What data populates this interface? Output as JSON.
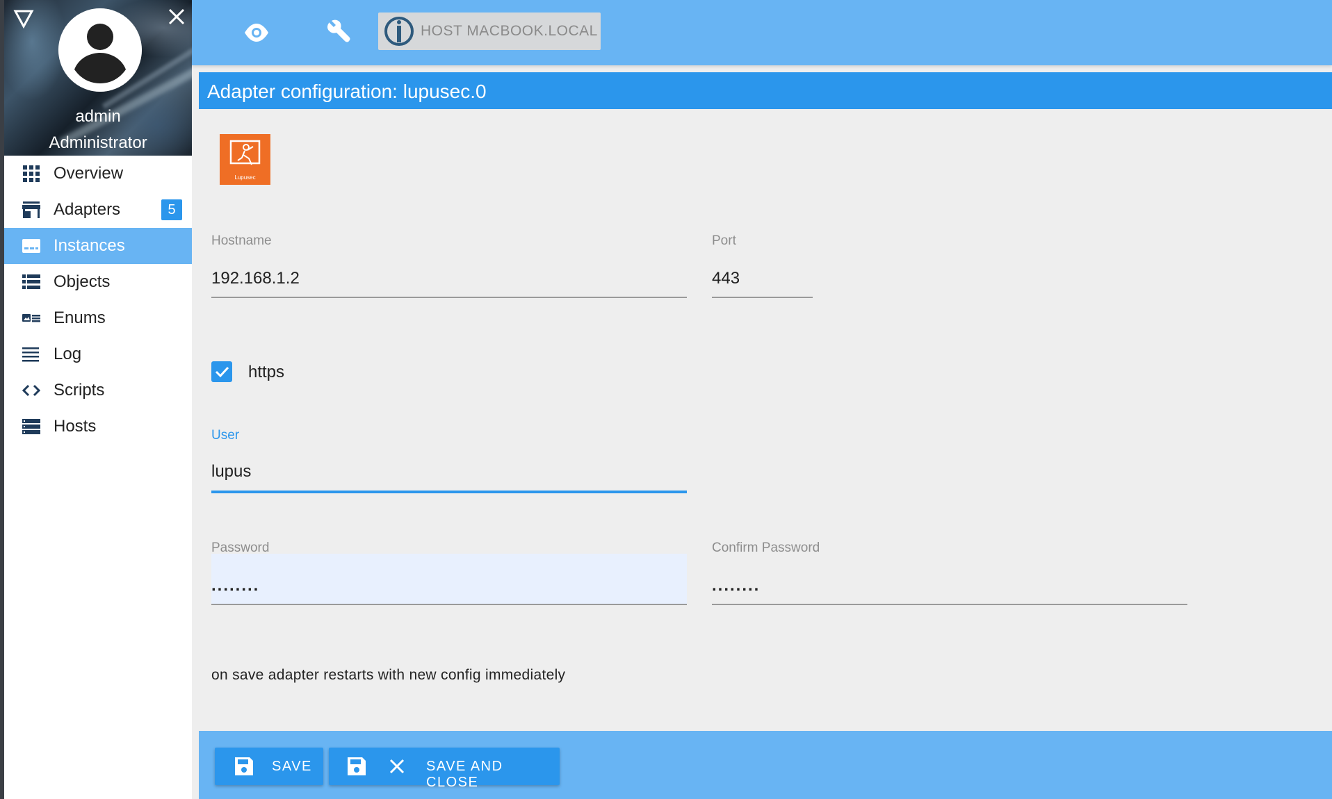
{
  "sidebar": {
    "user_name": "admin",
    "user_role": "Administrator",
    "items": [
      {
        "label": "Overview",
        "icon": "grid-icon"
      },
      {
        "label": "Adapters",
        "icon": "store-icon",
        "badge": "5"
      },
      {
        "label": "Instances",
        "icon": "instances-icon",
        "active": true
      },
      {
        "label": "Objects",
        "icon": "list-icon"
      },
      {
        "label": "Enums",
        "icon": "enum-icon"
      },
      {
        "label": "Log",
        "icon": "log-icon"
      },
      {
        "label": "Scripts",
        "icon": "code-icon"
      },
      {
        "label": "Hosts",
        "icon": "hosts-icon"
      }
    ]
  },
  "topbar": {
    "host_label": "HOST MACBOOK.LOCAL"
  },
  "page": {
    "title": "Adapter configuration: lupusec.0",
    "logo_caption": "Lupusec"
  },
  "form": {
    "hostname": {
      "label": "Hostname",
      "value": "192.168.1.2"
    },
    "port": {
      "label": "Port",
      "value": "443"
    },
    "https": {
      "label": "https",
      "checked": true
    },
    "user": {
      "label": "User",
      "value": "lupus"
    },
    "password": {
      "label": "Password",
      "value": "........"
    },
    "confirm_password": {
      "label": "Confirm Password",
      "value": "........"
    },
    "note": "on save adapter restarts with new config immediately"
  },
  "actions": {
    "save_label": "SAVE",
    "save_close_label": "SAVE AND CLOSE"
  },
  "colors": {
    "primary": "#2b96ec",
    "primary_light": "#68b4f3",
    "logo_orange": "#ef6e25",
    "background": "#eeeeee"
  }
}
